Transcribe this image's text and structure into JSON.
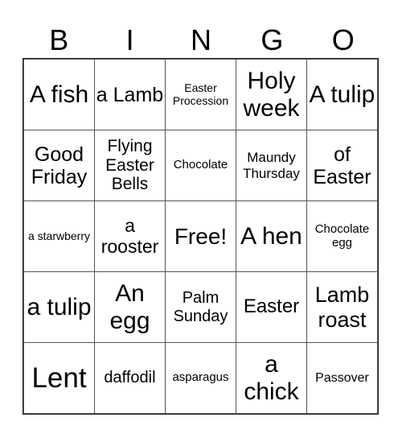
{
  "header": [
    "B",
    "I",
    "N",
    "G",
    "O"
  ],
  "rows": [
    [
      {
        "text": "A fish",
        "size": 30
      },
      {
        "text": "a Lamb",
        "size": 25
      },
      {
        "text": "Easter Procession",
        "size": 14
      },
      {
        "text": "Holy week",
        "size": 30
      },
      {
        "text": "A tulip",
        "size": 30
      }
    ],
    [
      {
        "text": "Good Friday",
        "size": 25
      },
      {
        "text": "Flying Easter Bells",
        "size": 21
      },
      {
        "text": "Chocolate",
        "size": 15
      },
      {
        "text": "Maundy Thursday",
        "size": 17
      },
      {
        "text": "of Easter",
        "size": 25
      }
    ],
    [
      {
        "text": "a starwberry",
        "size": 14
      },
      {
        "text": "a rooster",
        "size": 23
      },
      {
        "text": "Free!",
        "size": 28
      },
      {
        "text": "A hen",
        "size": 30
      },
      {
        "text": "Chocolate egg",
        "size": 15
      }
    ],
    [
      {
        "text": "a tulip",
        "size": 30
      },
      {
        "text": "An egg",
        "size": 30
      },
      {
        "text": "Palm Sunday",
        "size": 20
      },
      {
        "text": "Easter",
        "size": 24
      },
      {
        "text": "Lamb roast",
        "size": 27
      }
    ],
    [
      {
        "text": "Lent",
        "size": 35
      },
      {
        "text": "daffodil",
        "size": 20
      },
      {
        "text": "asparagus",
        "size": 15
      },
      {
        "text": "a chick",
        "size": 30
      },
      {
        "text": "Passover",
        "size": 16
      }
    ]
  ]
}
